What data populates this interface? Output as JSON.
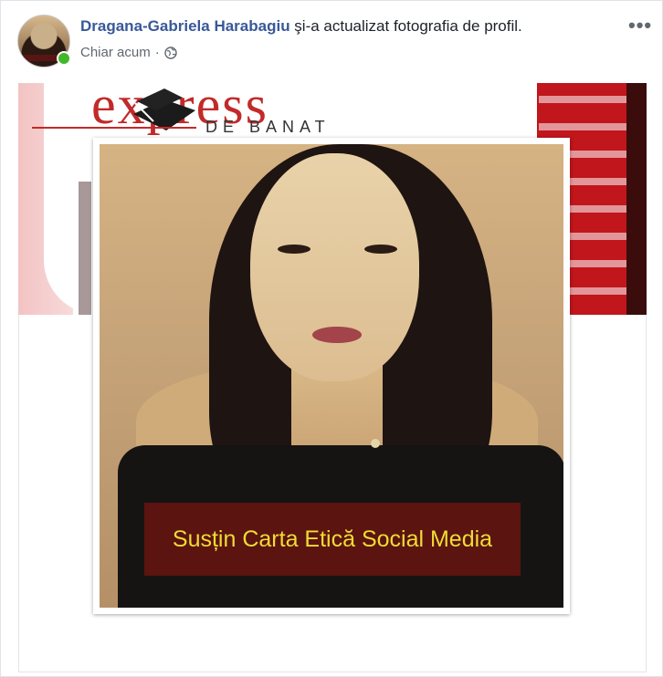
{
  "post": {
    "author_name": "Dragana-Gabriela Harabagiu",
    "action_text": " şi-a actualizat fotografia de profil.",
    "timestamp": "Chiar acum",
    "separator": "·",
    "privacy_icon": "globe-icon",
    "more_icon": "more-horizontal-icon",
    "more_label": "•••"
  },
  "cover_photo": {
    "logo_text": "express",
    "logo_sub": "DE BANAT",
    "brand_colors": [
      "#c22a2a",
      "#c0161c"
    ]
  },
  "profile_photo": {
    "caption": "Susțin Carta Etică Social Media",
    "caption_color": "#f0dc34",
    "caption_background": "#5b1410"
  },
  "colors": {
    "author_link": "#385898",
    "meta_text": "#616770",
    "online_status": "#42b72a"
  }
}
